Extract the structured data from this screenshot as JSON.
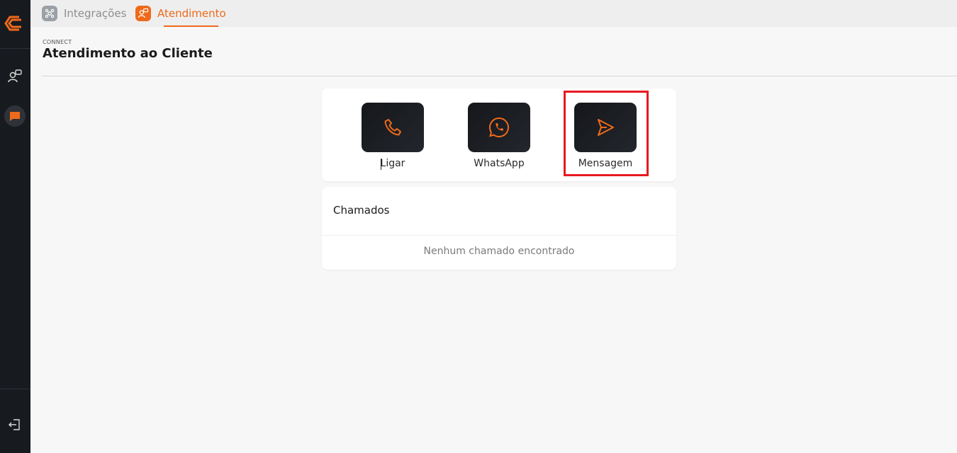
{
  "sidebar": {
    "logo_icon": "connect-logo-icon",
    "items": [
      {
        "icon": "agent-support-icon"
      },
      {
        "icon": "chat-icon",
        "active": true
      }
    ],
    "logout_icon": "logout-icon"
  },
  "topbar": {
    "tabs": [
      {
        "label": "Integrações",
        "icon": "integrations-icon",
        "active": false
      },
      {
        "label": "Atendimento",
        "icon": "agent-support-icon",
        "active": true
      }
    ]
  },
  "page": {
    "breadcrumb": "CONNECT",
    "title": "Atendimento ao Cliente"
  },
  "actions": [
    {
      "label": "Ligar",
      "icon": "phone-icon"
    },
    {
      "label": "WhatsApp",
      "icon": "whatsapp-icon"
    },
    {
      "label": "Mensagem",
      "icon": "send-icon",
      "highlighted": true
    }
  ],
  "chamados": {
    "title": "Chamados",
    "empty_text": "Nenhum chamado encontrado"
  },
  "colors": {
    "accent": "#ee6a1a",
    "sidebar_bg": "#171a1f",
    "highlight": "#e8191f",
    "tile_bg": "#1a1d22"
  }
}
